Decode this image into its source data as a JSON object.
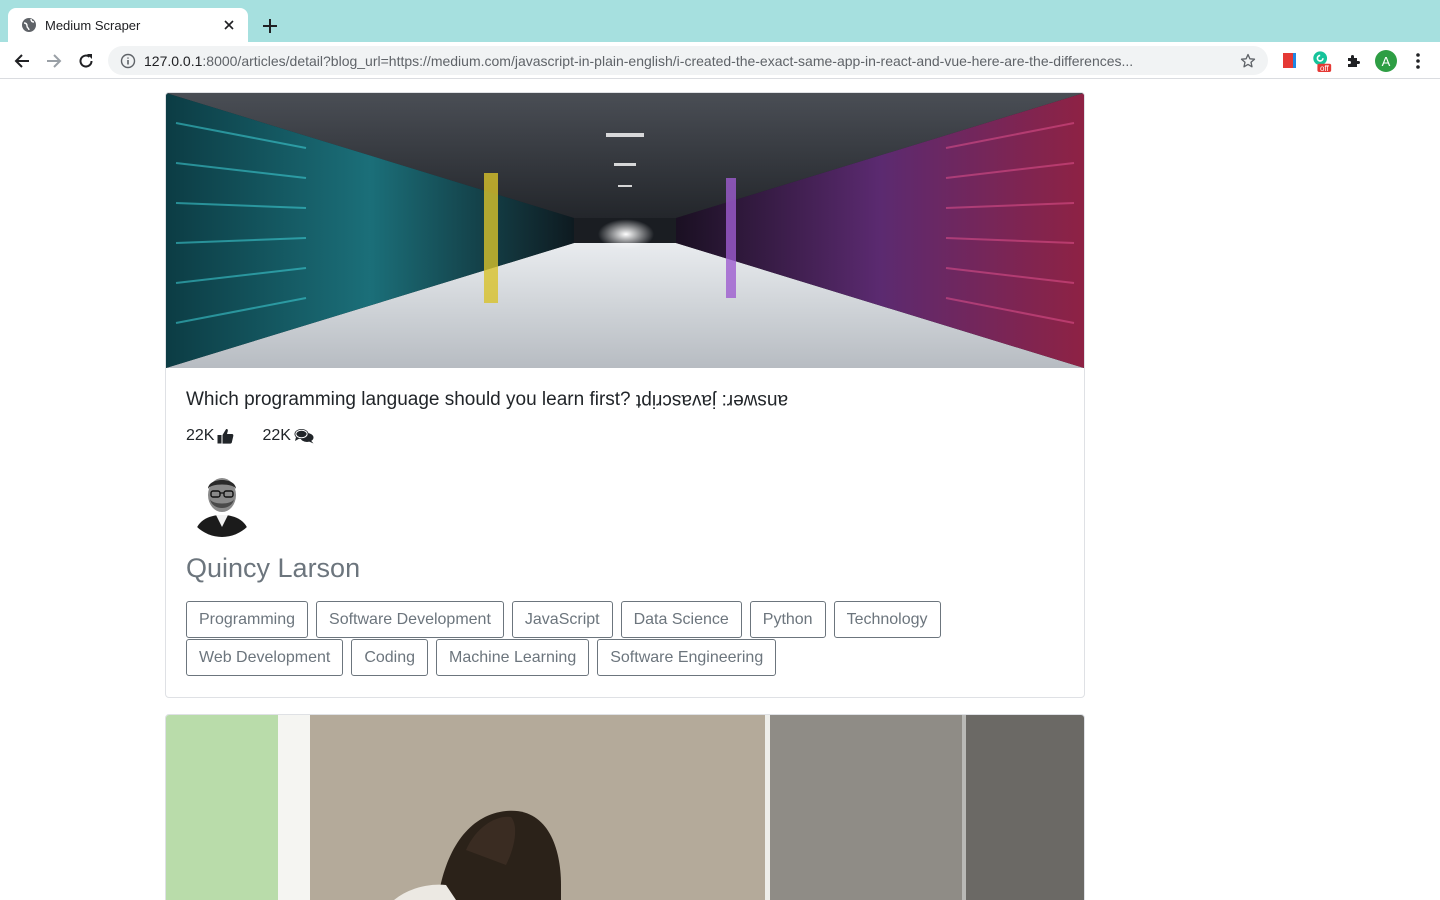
{
  "browser": {
    "tab_title": "Medium Scraper",
    "url_host": "127.0.0.1",
    "url_rest": ":8000/articles/detail?blog_url=https://medium.com/javascript-in-plain-english/i-created-the-exact-same-app-in-react-and-vue-here-are-the-differences...",
    "profile_initial": "A",
    "extension_badge": "off",
    "accent_color": "#a6e0df"
  },
  "articles": [
    {
      "title": "Which programming language should you learn first?",
      "title_flipped": "answer: javascript",
      "likes": "22K",
      "comments": "22K",
      "author": "Quincy Larson",
      "image": "server-room-photo",
      "tags": [
        "Programming",
        "Software Development",
        "JavaScript",
        "Data Science",
        "Python",
        "Technology",
        "Web Development",
        "Coding",
        "Machine Learning",
        "Software Engineering"
      ]
    },
    {
      "image": "person-at-desk-photo"
    }
  ],
  "icons": {
    "like": "thumbs-up-icon",
    "comment": "comments-icon"
  }
}
